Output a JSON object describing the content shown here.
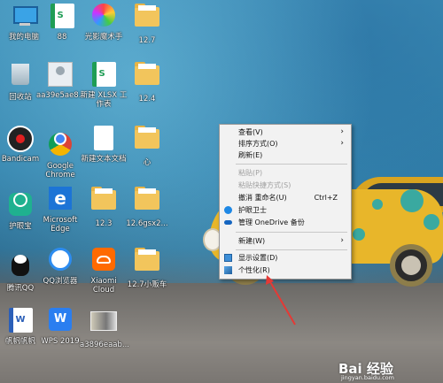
{
  "desktop_icons": [
    {
      "label": "我的电脑",
      "icon": "computer-icon"
    },
    {
      "label": "88",
      "icon": "excel-doc-icon"
    },
    {
      "label": "光影魔术手",
      "icon": "photo-app-icon"
    },
    {
      "label": "12.7",
      "icon": "folder-icon"
    },
    {
      "label": "回收站",
      "icon": "recycle-bin-icon"
    },
    {
      "label": "aa39e5ae8...",
      "icon": "image-file-icon"
    },
    {
      "label": "新建 XLSX 工作表",
      "icon": "excel-doc-icon"
    },
    {
      "label": "12.4",
      "icon": "folder-icon"
    },
    {
      "label": "Bandicam",
      "icon": "bandicam-icon"
    },
    {
      "label": "Google Chrome",
      "icon": "chrome-icon"
    },
    {
      "label": "新建文本文档",
      "icon": "text-doc-icon"
    },
    {
      "label": "心",
      "icon": "folder-icon"
    },
    {
      "label": "护眼宝",
      "icon": "eye-care-icon"
    },
    {
      "label": "Microsoft Edge",
      "icon": "edge-icon"
    },
    {
      "label": "12.3",
      "icon": "folder-icon"
    },
    {
      "label": "12.6gsx2...",
      "icon": "folder-icon"
    },
    {
      "label": "腾讯QQ",
      "icon": "qq-icon"
    },
    {
      "label": "QQ浏览器",
      "icon": "qq-browser-icon"
    },
    {
      "label": "Xiaomi Cloud",
      "icon": "xiaomi-cloud-icon"
    },
    {
      "label": "12.7小贩车",
      "icon": "folder-icon"
    },
    {
      "label": "帆帆帆帆",
      "icon": "word-doc-icon"
    },
    {
      "label": "WPS 2019",
      "icon": "wps-icon"
    },
    {
      "label": "a3896eaab...",
      "icon": "image-file-icon"
    }
  ],
  "context_menu": {
    "items": [
      {
        "label": "查看(V)",
        "submenu": "›",
        "disabled": false
      },
      {
        "label": "排序方式(O)",
        "submenu": "›",
        "disabled": false
      },
      {
        "label": "刷新(E)",
        "disabled": false
      },
      {
        "label": "粘贴(P)",
        "disabled": true
      },
      {
        "label": "粘贴快捷方式(S)",
        "disabled": true
      },
      {
        "label": "撤消 重命名(U)",
        "shortcut": "Ctrl+Z",
        "disabled": false
      },
      {
        "label": "护眼卫士",
        "icon": "shield-icon",
        "disabled": false
      },
      {
        "label": "管理 OneDrive 备份",
        "icon": "onedrive-icon",
        "disabled": false
      },
      {
        "label": "新建(W)",
        "submenu": "›",
        "disabled": false
      },
      {
        "label": "显示设置(D)",
        "icon": "display-icon",
        "disabled": false
      },
      {
        "label": "个性化(R)",
        "icon": "personalize-icon",
        "disabled": false
      }
    ]
  },
  "watermark": {
    "brand": "Bai 经验",
    "url": "jingyan.baidu.com"
  },
  "colors": {
    "menu_bg": "#f2f2f2",
    "annotation_arrow": "#e53935",
    "car": "#e8b62a"
  }
}
